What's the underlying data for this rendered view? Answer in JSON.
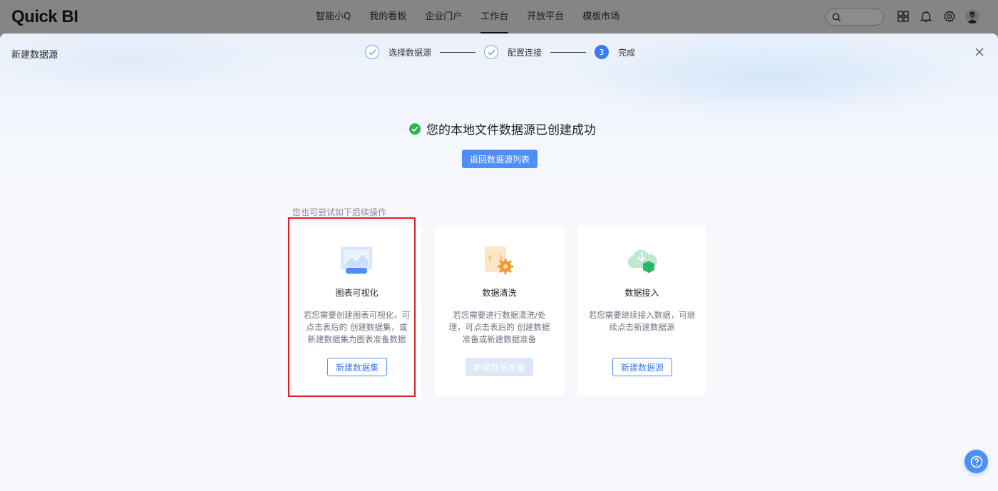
{
  "topbar": {
    "logo": "Quick BI",
    "nav": [
      "智能小Q",
      "我的看板",
      "企业门户",
      "工作台",
      "开放平台",
      "模板市场"
    ],
    "active_nav": "工作台",
    "icons": [
      "search-icon",
      "apps-grid-icon",
      "bell-icon",
      "gear-icon",
      "avatar"
    ]
  },
  "modal": {
    "title": "新建数据源",
    "steps": [
      {
        "label": "选择数据源",
        "status": "done"
      },
      {
        "label": "配置连接",
        "status": "done"
      },
      {
        "number": "3",
        "label": "完成",
        "status": "current"
      }
    ],
    "success_message": "您的本地文件数据源已创建成功",
    "back_button": "返回数据源列表",
    "hint": "您也可尝试如下后续操作",
    "cards": [
      {
        "title": "图表可视化",
        "description": "若您需要创建图表可视化，可点击表后的 创建数据集，或新建数据集为图表准备数据",
        "button": "新建数据集",
        "icon": "chart-visualization-icon",
        "disabled": false
      },
      {
        "title": "数据清洗",
        "description": "若您需要进行数据清洗/处理，可点击表后的 创建数据准备或新建数据准备",
        "button": "新建数据准备",
        "icon": "data-cleaning-icon",
        "disabled": true
      },
      {
        "title": "数据接入",
        "description": "若您需要继续接入数据，可继续点击新建数据源",
        "button": "新建数据源",
        "icon": "data-ingestion-icon",
        "disabled": false
      }
    ]
  },
  "colors": {
    "primary": "#4d8ff5",
    "success": "#2fb64a",
    "highlight": "#e02020"
  }
}
